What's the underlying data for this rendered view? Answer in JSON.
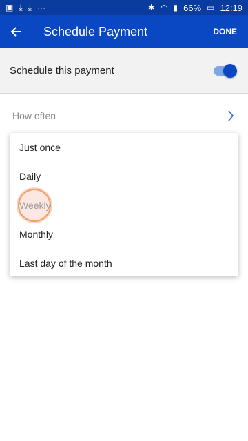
{
  "status_bar": {
    "left_icons": [
      "image-icon",
      "download-icon",
      "download-icon",
      "more-dots-icon"
    ],
    "bluetooth": "bluetooth-icon",
    "wifi": "wifi-icon",
    "signal": "signal-icon",
    "battery_percent": "66%",
    "time": "12:19"
  },
  "app_bar": {
    "back_icon": "arrow-left-icon",
    "title": "Schedule Payment",
    "done_label": "DONE"
  },
  "schedule_toggle": {
    "label": "Schedule this payment",
    "enabled": true
  },
  "how_often_field": {
    "placeholder": "How often",
    "chevron_icon": "chevron-right-icon"
  },
  "frequency_menu": {
    "items": [
      {
        "label": "Just once"
      },
      {
        "label": "Daily"
      },
      {
        "label": "Weekly",
        "pressed": true
      },
      {
        "label": "Monthly"
      },
      {
        "label": "Last day of the month"
      }
    ]
  },
  "colors": {
    "status_bar_bg": "#0a3c9f",
    "app_bar_bg": "#0a47c2",
    "toggle_track": "#7fa4e8",
    "toggle_thumb": "#0a47c2",
    "chevron": "#3a7bd5"
  }
}
